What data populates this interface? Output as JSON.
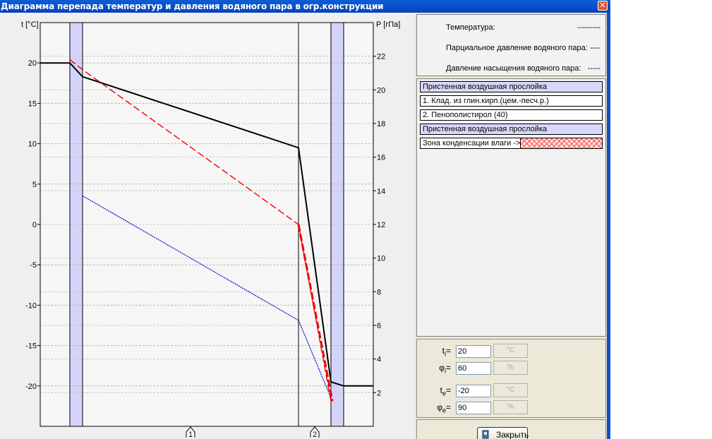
{
  "window": {
    "title": "Диаграмма перепада температур и давления водяного пара в огр.конструкции",
    "close_glyph": "✕"
  },
  "legend": {
    "items": [
      {
        "label": "Температура:",
        "dashes": "---------",
        "color": "#000000",
        "style": "solid"
      },
      {
        "label": "Парциальное давление водяного пара:",
        "dashes": "----",
        "color": "#0000cc",
        "style": "dotted"
      },
      {
        "label": "Давление насыщения водяного пара:",
        "dashes": "-----",
        "color": "#ee0000",
        "style": "dashed"
      }
    ]
  },
  "layers": {
    "items": [
      {
        "label": "Пристенная воздушная прослойка",
        "kind": "air"
      },
      {
        "label": "1. Клад. из глин.кирп.(цем.-песч.р.)",
        "kind": "material"
      },
      {
        "label": "2. Пенополистирол (40)",
        "kind": "material"
      },
      {
        "label": "Пристенная воздушная прослойка",
        "kind": "air"
      }
    ],
    "condensation_label": "Зона конденсации влаги ->"
  },
  "params": {
    "ti": {
      "sym": "t",
      "sub": "i",
      "value": "20",
      "unit": "°C"
    },
    "phii": {
      "sym": "φ",
      "sub": "i",
      "value": "60",
      "unit": "%"
    },
    "te": {
      "sym": "t",
      "sub": "e",
      "value": "-20",
      "unit": "°C"
    },
    "phie": {
      "sym": "φ",
      "sub": "e",
      "value": "90",
      "unit": "%"
    }
  },
  "buttons": {
    "close_label": "Закрыть"
  },
  "chart_data": {
    "type": "line",
    "y_left": {
      "label": "t [°C]",
      "ticks": [
        20,
        15,
        10,
        5,
        0,
        -5,
        -10,
        -15,
        -20
      ],
      "range": [
        -25,
        25
      ]
    },
    "y_right": {
      "label": "P [гПа]",
      "ticks": [
        22,
        20,
        18,
        16,
        14,
        12,
        10,
        8,
        6,
        4,
        2
      ],
      "range": [
        0,
        24
      ]
    },
    "x_markers": [
      "1",
      "2"
    ],
    "grid": true,
    "layers_x": {
      "boundaries": [
        0,
        42,
        60,
        366,
        412,
        430,
        472
      ],
      "air_layers": [
        [
          42,
          60
        ],
        [
          412,
          430
        ]
      ]
    },
    "series": [
      {
        "name": "Температура",
        "axis": "left",
        "color": "#000000",
        "points": [
          [
            0,
            20
          ],
          [
            42,
            20
          ],
          [
            60,
            18.3
          ],
          [
            366,
            9.5
          ],
          [
            412,
            -19.5
          ],
          [
            430,
            -20
          ],
          [
            472,
            -20
          ]
        ]
      },
      {
        "name": "Парциальное давление водяного пара",
        "axis": "right",
        "color": "#0000cc",
        "points": [
          [
            60,
            13.7
          ],
          [
            366,
            6.3
          ],
          [
            412,
            1.7
          ]
        ]
      },
      {
        "name": "Давление насыщения водяного пара",
        "axis": "right",
        "color": "#ee0000",
        "points": [
          [
            42,
            21.8
          ],
          [
            60,
            21.2
          ],
          [
            366,
            12.0
          ],
          [
            412,
            1.5
          ]
        ]
      }
    ]
  }
}
